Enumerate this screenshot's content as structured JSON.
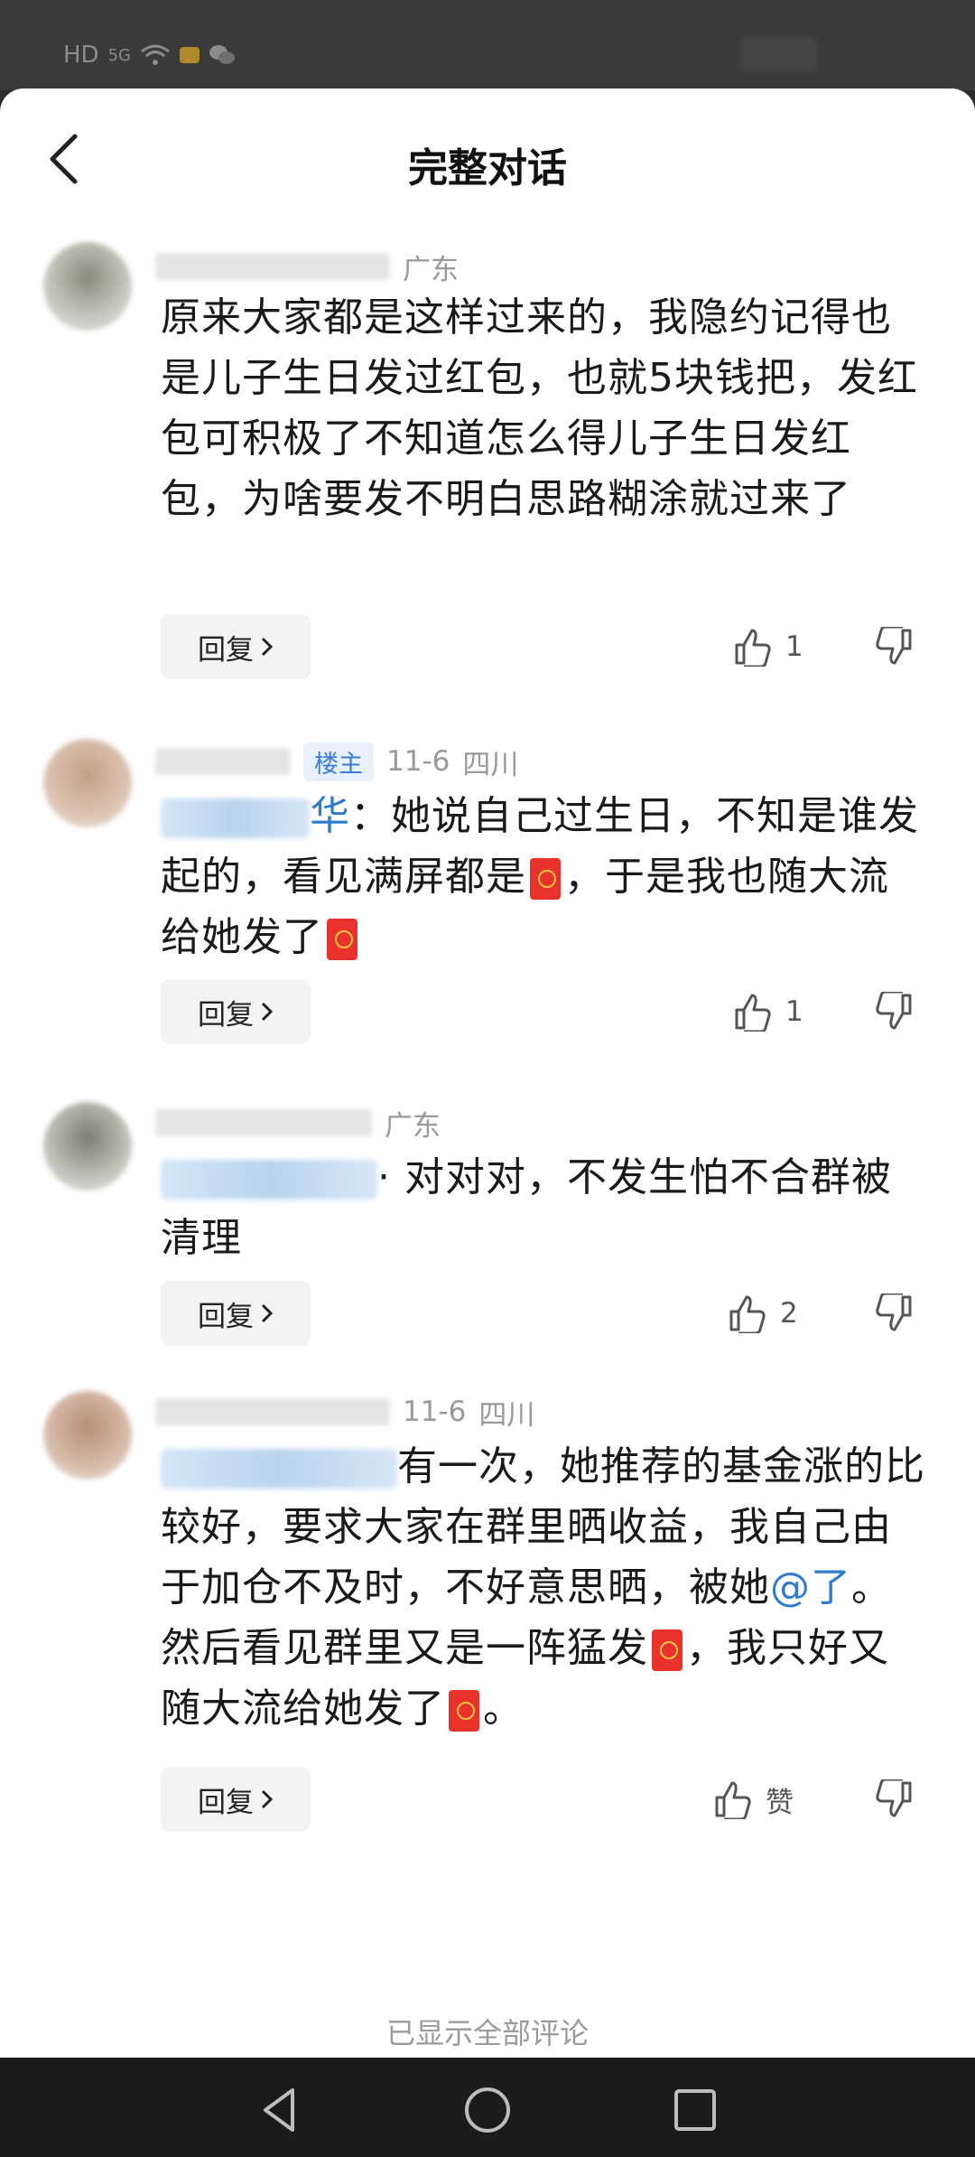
{
  "status_bar": {
    "network": "HD",
    "signal": "5G",
    "icons": [
      "hd-icon",
      "signal-icon",
      "wifi-icon",
      "notification-icon",
      "wechat-icon"
    ]
  },
  "header": {
    "title": "完整对话",
    "back_icon": "chevron-left-icon"
  },
  "comments": [
    {
      "location": "广东",
      "date": "",
      "text": "原来大家都是这样过来的，我隐约记得也是儿子生日发过红包，也就5块钱把，发红包可积极了不知道怎么得儿子生日发红包，为啥要发不明白思路糊涂就过来了",
      "reply_label": "回复",
      "likes": "1"
    },
    {
      "tag": "楼主",
      "date": "11-6",
      "location": "四川",
      "prefix_tail": "华",
      "text1": "：她说自己过生日，不知是谁发起的，看见满屏都是",
      "text2": "，于是我也随大流给她发了",
      "reply_label": "回复",
      "likes": "1"
    },
    {
      "location": "广东",
      "text": "· 对对对，不发生怕不合群被清理",
      "reply_label": "回复",
      "likes": "2"
    },
    {
      "date": "11-6",
      "location": "四川",
      "text1": "有一次，她推荐的基金涨的比较好，要求大家在群里晒收益，我自己由于加仓不及时，不好意思晒，被她",
      "at": "@了",
      "text2": "。然后看见群里又是一阵猛发",
      "text3": "，我只好又随大流给她发了",
      "text4": "。",
      "reply_label": "回复",
      "likes": "赞"
    }
  ],
  "footer": "已显示全部评论",
  "colors": {
    "accent": "#2f7ccf",
    "redpacket": "#e9322c",
    "tag_bg": "#e8f1fb"
  }
}
